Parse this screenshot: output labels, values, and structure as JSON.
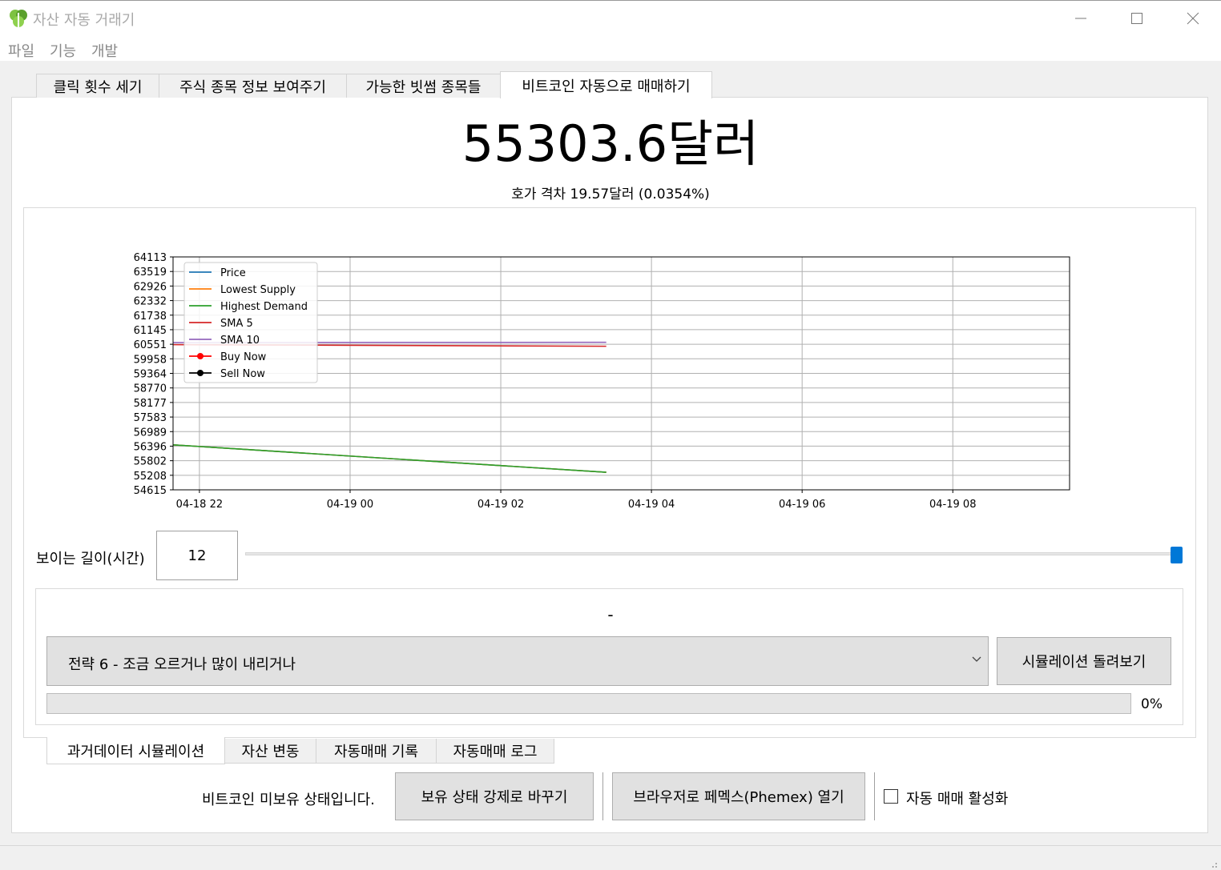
{
  "window": {
    "title": "자산 자동 거래기",
    "icon": "app-leaf-icon",
    "controls": [
      "minimize-icon",
      "maximize-icon",
      "close-icon"
    ]
  },
  "menu": {
    "items": [
      "파일",
      "기능",
      "개발"
    ]
  },
  "tabs": [
    {
      "label": "클릭 횟수 세기",
      "active": false
    },
    {
      "label": "주식 종목 정보 보여주기",
      "active": false
    },
    {
      "label": "가능한 빗썸 종목들",
      "active": false
    },
    {
      "label": "비트코인 자동으로 매매하기",
      "active": true
    }
  ],
  "ticker": {
    "price": "55303.6달러",
    "spread": "호가 격차 19.57달러 (0.0354%)"
  },
  "chart_data": {
    "type": "line",
    "y_ticks": [
      "64113",
      "63519",
      "62926",
      "62332",
      "61738",
      "61145",
      "60551",
      "59958",
      "59364",
      "58770",
      "58177",
      "57583",
      "56989",
      "56396",
      "55802",
      "55208",
      "54615"
    ],
    "ylim": [
      54615,
      64113
    ],
    "x_ticks": [
      "04-18 22",
      "04-19 00",
      "04-19 02",
      "04-19 04",
      "04-19 06",
      "04-19 08"
    ],
    "xlim_hours": [
      -0.35,
      11.55
    ],
    "grid": true,
    "legend_position": "upper-left",
    "series": [
      {
        "name": "Price",
        "color": "#1f77b4",
        "x_hours": [
          -0.35,
          5.4
        ],
        "values": [
          56450,
          55330
        ]
      },
      {
        "name": "Lowest Supply",
        "color": "#ff7f0e",
        "x_hours": [
          -0.35,
          5.4
        ],
        "values": [
          56450,
          55330
        ]
      },
      {
        "name": "Highest Demand",
        "color": "#2ca02c",
        "x_hours": [
          -0.35,
          5.4
        ],
        "values": [
          56450,
          55330
        ]
      },
      {
        "name": "SMA 5",
        "color": "#d62728",
        "x_hours": [
          -0.35,
          5.4
        ],
        "values": [
          60535,
          60470
        ]
      },
      {
        "name": "SMA 10",
        "color": "#9467bd",
        "x_hours": [
          -0.35,
          5.4
        ],
        "values": [
          60620,
          60630
        ]
      },
      {
        "name": "Buy Now",
        "color": "#ff0000",
        "marker": true,
        "x_hours": [],
        "values": []
      },
      {
        "name": "Sell Now",
        "color": "#000000",
        "marker": true,
        "x_hours": [],
        "values": []
      }
    ]
  },
  "view_length": {
    "label": "보이는 길이(시간)",
    "value": "12",
    "slider_fraction": 1.0
  },
  "simulation": {
    "status": "-",
    "strategy": "전략 6 - 조금 오르거나 많이 내리거나",
    "run_button": "시뮬레이션 돌려보기",
    "progress": "0%",
    "progress_value": 0
  },
  "sub_tabs": [
    {
      "label": "과거데이터 시뮬레이션",
      "active": true
    },
    {
      "label": "자산 변동",
      "active": false
    },
    {
      "label": "자동매매 기록",
      "active": false
    },
    {
      "label": "자동매매 로그",
      "active": false
    }
  ],
  "holding": {
    "status": "비트코인 미보유 상태입니다.",
    "force_button": "보유 상태 강제로 바꾸기",
    "open_browser_button": "브라우저로 페멕스(Phemex) 열기",
    "auto_trade_label": "자동 매매 활성화",
    "auto_trade_checked": false
  }
}
